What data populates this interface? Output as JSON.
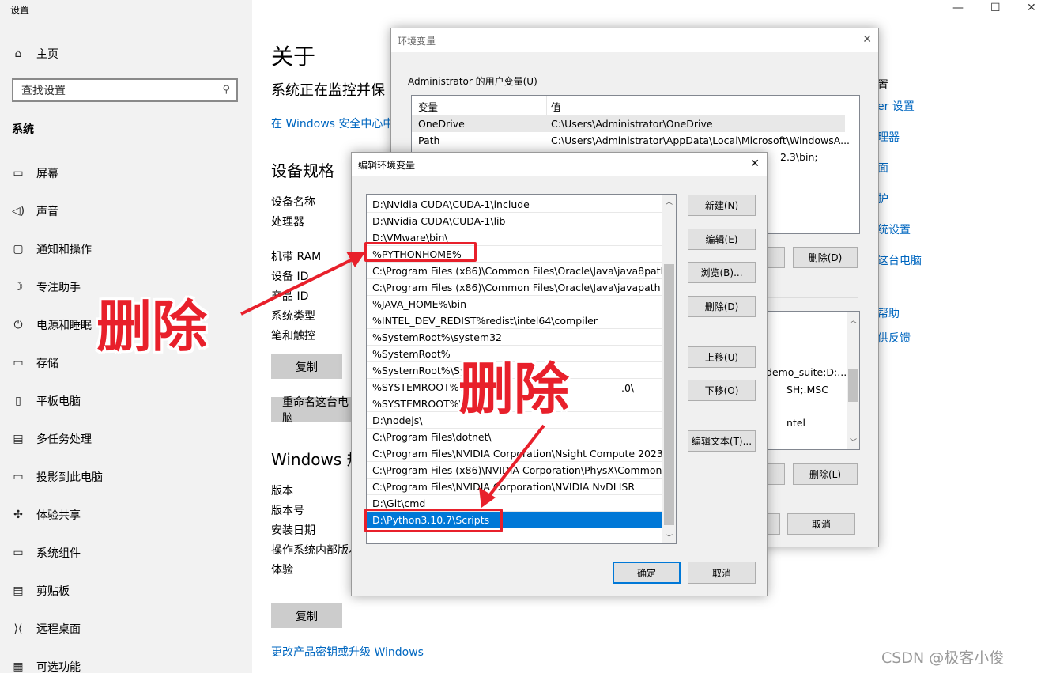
{
  "window": {
    "title": "设置",
    "minimize_glyph": "—",
    "maximize_glyph": "☐",
    "close_glyph": "✕"
  },
  "sidebar": {
    "home": "主页",
    "search_placeholder": "查找设置",
    "section": "系统",
    "items": [
      {
        "label": "屏幕",
        "icon": "monitor-icon",
        "glyph": "▭"
      },
      {
        "label": "声音",
        "icon": "speaker-icon",
        "glyph": "◁)"
      },
      {
        "label": "通知和操作",
        "icon": "notification-icon",
        "glyph": "▢"
      },
      {
        "label": "专注助手",
        "icon": "moon-icon",
        "glyph": "☽"
      },
      {
        "label": "电源和睡眠",
        "icon": "power-icon",
        "glyph": "⏻"
      },
      {
        "label": "存储",
        "icon": "storage-icon",
        "glyph": "▭"
      },
      {
        "label": "平板电脑",
        "icon": "tablet-icon",
        "glyph": "▯"
      },
      {
        "label": "多任务处理",
        "icon": "multitask-icon",
        "glyph": "▤"
      },
      {
        "label": "投影到此电脑",
        "icon": "project-icon",
        "glyph": "▭"
      },
      {
        "label": "体验共享",
        "icon": "share-icon",
        "glyph": "✣"
      },
      {
        "label": "系统组件",
        "icon": "components-icon",
        "glyph": "▭"
      },
      {
        "label": "剪贴板",
        "icon": "clipboard-icon",
        "glyph": "▤"
      },
      {
        "label": "远程桌面",
        "icon": "remote-icon",
        "glyph": "⟩⟨"
      },
      {
        "label": "可选功能",
        "icon": "optional-icon",
        "glyph": "▦"
      }
    ]
  },
  "main": {
    "title": "关于",
    "monitor_text": "系统正在监控并保",
    "security_link": "在 Windows 安全中心中",
    "device_spec_title": "设备规格",
    "device_name": "设备名称",
    "processor": "处理器",
    "ram": "机带 RAM",
    "device_id": "设备 ID",
    "product_id": "产品 ID",
    "system_type": "系统类型",
    "pen_touch": "笔和触控",
    "copy1": "复制",
    "rename": "重命名这台电脑",
    "windows_spec_title": "Windows 规",
    "version": "版本",
    "version_no": "版本号",
    "install_date": "安装日期",
    "os_build": "操作系统内部版本",
    "experience": "体验",
    "copy2": "复制",
    "upgrade_link": "更改产品密钥或升级 Windows",
    "right_links": [
      "置",
      "er 设置",
      "理器",
      "面",
      "护",
      "统设置",
      "这台电脑",
      "帮助",
      "供反馈"
    ]
  },
  "env_dialog": {
    "title": "环境变量",
    "user_group": "Administrator 的用户变量(U)",
    "col_var": "变量",
    "col_val": "值",
    "rows": [
      {
        "var": "OneDrive",
        "val": "C:\\Users\\Administrator\\OneDrive"
      },
      {
        "var": "Path",
        "val": "C:\\Users\\Administrator\\AppData\\Local\\Microsoft\\WindowsA..."
      }
    ],
    "partial_row": "2.3\\bin;",
    "delete_user": "删除(D)",
    "sys_fragments": [
      "demo_suite;D:...",
      "SH;.MSC",
      "ntel"
    ],
    "delete_sys": "删除(L)",
    "cancel": "取消"
  },
  "edit_dialog": {
    "title": "编辑环境变量",
    "entries": [
      "D:\\Nvidia CUDA\\CUDA-1\\include",
      "D:\\Nvidia CUDA\\CUDA-1\\lib",
      "D:\\VMware\\bin\\",
      "%PYTHONHOME%",
      "C:\\Program Files (x86)\\Common Files\\Oracle\\Java\\java8path",
      "C:\\Program Files (x86)\\Common Files\\Oracle\\Java\\javapath",
      "%JAVA_HOME%\\bin",
      "%INTEL_DEV_REDIST%redist\\intel64\\compiler",
      "%SystemRoot%\\system32",
      "%SystemRoot%",
      "%SystemRoot%\\Sys",
      "%SYSTEMROOT%\\",
      "%SYSTEMROOT%\\",
      "D:\\nodejs\\",
      "C:\\Program Files\\dotnet\\",
      "C:\\Program Files\\NVIDIA Corporation\\Nsight Compute 2023....",
      "C:\\Program Files (x86)\\NVIDIA Corporation\\PhysX\\Common",
      "C:\\Program Files\\NVIDIA Corporation\\NVIDIA NvDLISR",
      "D:\\Git\\cmd",
      "D:\\Python3.10.7\\Scripts"
    ],
    "entry_suffix": ".0\\",
    "selected_index": 19,
    "buttons": {
      "new": "新建(N)",
      "edit": "编辑(E)",
      "browse": "浏览(B)...",
      "delete": "删除(D)",
      "up": "上移(U)",
      "down": "下移(O)",
      "edit_text": "编辑文本(T)..."
    },
    "ok": "确定",
    "cancel": "取消"
  },
  "annotations": {
    "delete_label_1": "删除",
    "delete_label_2": "删除",
    "color": "#e8202b"
  },
  "watermark": "CSDN @极客小俊"
}
